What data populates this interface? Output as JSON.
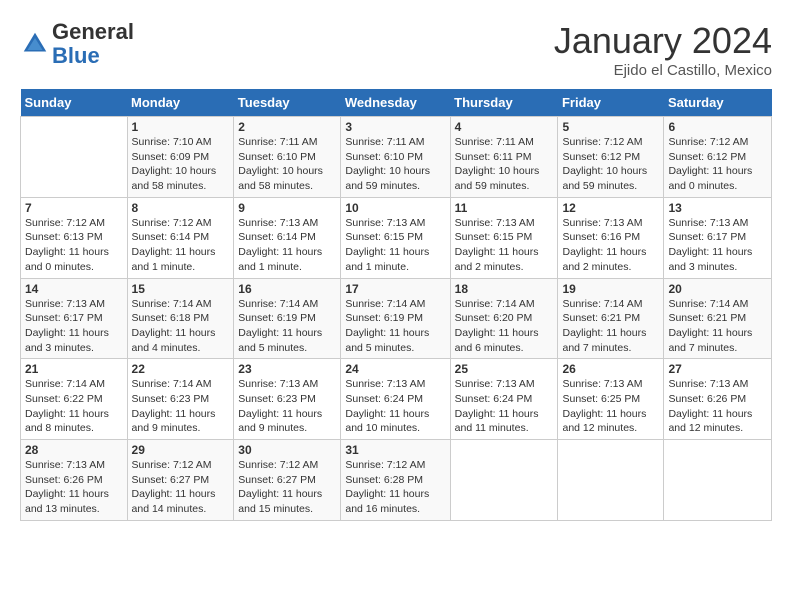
{
  "header": {
    "logo_general": "General",
    "logo_blue": "Blue",
    "month_title": "January 2024",
    "subtitle": "Ejido el Castillo, Mexico"
  },
  "weekdays": [
    "Sunday",
    "Monday",
    "Tuesday",
    "Wednesday",
    "Thursday",
    "Friday",
    "Saturday"
  ],
  "weeks": [
    [
      {
        "day": "",
        "sunrise": "",
        "sunset": "",
        "daylight": ""
      },
      {
        "day": "1",
        "sunrise": "Sunrise: 7:10 AM",
        "sunset": "Sunset: 6:09 PM",
        "daylight": "Daylight: 10 hours and 58 minutes."
      },
      {
        "day": "2",
        "sunrise": "Sunrise: 7:11 AM",
        "sunset": "Sunset: 6:10 PM",
        "daylight": "Daylight: 10 hours and 58 minutes."
      },
      {
        "day": "3",
        "sunrise": "Sunrise: 7:11 AM",
        "sunset": "Sunset: 6:10 PM",
        "daylight": "Daylight: 10 hours and 59 minutes."
      },
      {
        "day": "4",
        "sunrise": "Sunrise: 7:11 AM",
        "sunset": "Sunset: 6:11 PM",
        "daylight": "Daylight: 10 hours and 59 minutes."
      },
      {
        "day": "5",
        "sunrise": "Sunrise: 7:12 AM",
        "sunset": "Sunset: 6:12 PM",
        "daylight": "Daylight: 10 hours and 59 minutes."
      },
      {
        "day": "6",
        "sunrise": "Sunrise: 7:12 AM",
        "sunset": "Sunset: 6:12 PM",
        "daylight": "Daylight: 11 hours and 0 minutes."
      }
    ],
    [
      {
        "day": "7",
        "sunrise": "Sunrise: 7:12 AM",
        "sunset": "Sunset: 6:13 PM",
        "daylight": "Daylight: 11 hours and 0 minutes."
      },
      {
        "day": "8",
        "sunrise": "Sunrise: 7:12 AM",
        "sunset": "Sunset: 6:14 PM",
        "daylight": "Daylight: 11 hours and 1 minute."
      },
      {
        "day": "9",
        "sunrise": "Sunrise: 7:13 AM",
        "sunset": "Sunset: 6:14 PM",
        "daylight": "Daylight: 11 hours and 1 minute."
      },
      {
        "day": "10",
        "sunrise": "Sunrise: 7:13 AM",
        "sunset": "Sunset: 6:15 PM",
        "daylight": "Daylight: 11 hours and 1 minute."
      },
      {
        "day": "11",
        "sunrise": "Sunrise: 7:13 AM",
        "sunset": "Sunset: 6:15 PM",
        "daylight": "Daylight: 11 hours and 2 minutes."
      },
      {
        "day": "12",
        "sunrise": "Sunrise: 7:13 AM",
        "sunset": "Sunset: 6:16 PM",
        "daylight": "Daylight: 11 hours and 2 minutes."
      },
      {
        "day": "13",
        "sunrise": "Sunrise: 7:13 AM",
        "sunset": "Sunset: 6:17 PM",
        "daylight": "Daylight: 11 hours and 3 minutes."
      }
    ],
    [
      {
        "day": "14",
        "sunrise": "Sunrise: 7:13 AM",
        "sunset": "Sunset: 6:17 PM",
        "daylight": "Daylight: 11 hours and 3 minutes."
      },
      {
        "day": "15",
        "sunrise": "Sunrise: 7:14 AM",
        "sunset": "Sunset: 6:18 PM",
        "daylight": "Daylight: 11 hours and 4 minutes."
      },
      {
        "day": "16",
        "sunrise": "Sunrise: 7:14 AM",
        "sunset": "Sunset: 6:19 PM",
        "daylight": "Daylight: 11 hours and 5 minutes."
      },
      {
        "day": "17",
        "sunrise": "Sunrise: 7:14 AM",
        "sunset": "Sunset: 6:19 PM",
        "daylight": "Daylight: 11 hours and 5 minutes."
      },
      {
        "day": "18",
        "sunrise": "Sunrise: 7:14 AM",
        "sunset": "Sunset: 6:20 PM",
        "daylight": "Daylight: 11 hours and 6 minutes."
      },
      {
        "day": "19",
        "sunrise": "Sunrise: 7:14 AM",
        "sunset": "Sunset: 6:21 PM",
        "daylight": "Daylight: 11 hours and 7 minutes."
      },
      {
        "day": "20",
        "sunrise": "Sunrise: 7:14 AM",
        "sunset": "Sunset: 6:21 PM",
        "daylight": "Daylight: 11 hours and 7 minutes."
      }
    ],
    [
      {
        "day": "21",
        "sunrise": "Sunrise: 7:14 AM",
        "sunset": "Sunset: 6:22 PM",
        "daylight": "Daylight: 11 hours and 8 minutes."
      },
      {
        "day": "22",
        "sunrise": "Sunrise: 7:14 AM",
        "sunset": "Sunset: 6:23 PM",
        "daylight": "Daylight: 11 hours and 9 minutes."
      },
      {
        "day": "23",
        "sunrise": "Sunrise: 7:13 AM",
        "sunset": "Sunset: 6:23 PM",
        "daylight": "Daylight: 11 hours and 9 minutes."
      },
      {
        "day": "24",
        "sunrise": "Sunrise: 7:13 AM",
        "sunset": "Sunset: 6:24 PM",
        "daylight": "Daylight: 11 hours and 10 minutes."
      },
      {
        "day": "25",
        "sunrise": "Sunrise: 7:13 AM",
        "sunset": "Sunset: 6:24 PM",
        "daylight": "Daylight: 11 hours and 11 minutes."
      },
      {
        "day": "26",
        "sunrise": "Sunrise: 7:13 AM",
        "sunset": "Sunset: 6:25 PM",
        "daylight": "Daylight: 11 hours and 12 minutes."
      },
      {
        "day": "27",
        "sunrise": "Sunrise: 7:13 AM",
        "sunset": "Sunset: 6:26 PM",
        "daylight": "Daylight: 11 hours and 12 minutes."
      }
    ],
    [
      {
        "day": "28",
        "sunrise": "Sunrise: 7:13 AM",
        "sunset": "Sunset: 6:26 PM",
        "daylight": "Daylight: 11 hours and 13 minutes."
      },
      {
        "day": "29",
        "sunrise": "Sunrise: 7:12 AM",
        "sunset": "Sunset: 6:27 PM",
        "daylight": "Daylight: 11 hours and 14 minutes."
      },
      {
        "day": "30",
        "sunrise": "Sunrise: 7:12 AM",
        "sunset": "Sunset: 6:27 PM",
        "daylight": "Daylight: 11 hours and 15 minutes."
      },
      {
        "day": "31",
        "sunrise": "Sunrise: 7:12 AM",
        "sunset": "Sunset: 6:28 PM",
        "daylight": "Daylight: 11 hours and 16 minutes."
      },
      {
        "day": "",
        "sunrise": "",
        "sunset": "",
        "daylight": ""
      },
      {
        "day": "",
        "sunrise": "",
        "sunset": "",
        "daylight": ""
      },
      {
        "day": "",
        "sunrise": "",
        "sunset": "",
        "daylight": ""
      }
    ]
  ]
}
